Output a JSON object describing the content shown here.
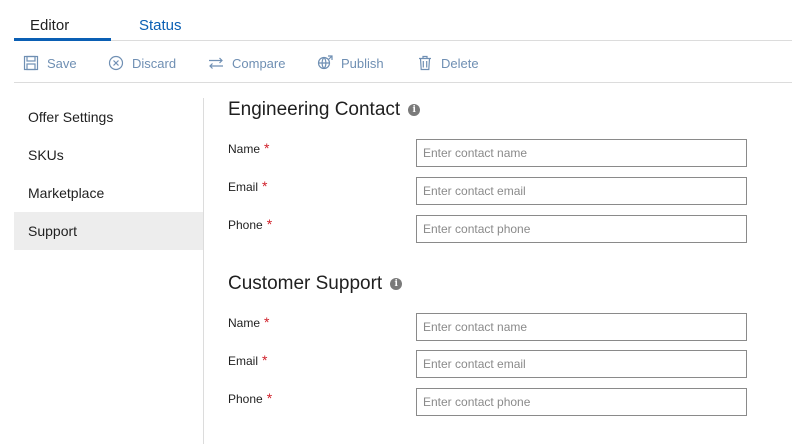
{
  "tabs": [
    {
      "label": "Editor"
    },
    {
      "label": "Status"
    }
  ],
  "toolbar": {
    "save": "Save",
    "discard": "Discard",
    "compare": "Compare",
    "publish": "Publish",
    "delete": "Delete"
  },
  "sidebar": {
    "items": [
      {
        "label": "Offer Settings"
      },
      {
        "label": "SKUs"
      },
      {
        "label": "Marketplace"
      },
      {
        "label": "Support"
      }
    ]
  },
  "engineering": {
    "title": "Engineering Contact",
    "name_label": "Name",
    "name_placeholder": "Enter contact name",
    "email_label": "Email",
    "email_placeholder": "Enter contact email",
    "phone_label": "Phone",
    "phone_placeholder": "Enter contact phone"
  },
  "customer": {
    "title": "Customer Support",
    "name_label": "Name",
    "name_placeholder": "Enter contact name",
    "email_label": "Email",
    "email_placeholder": "Enter contact email",
    "phone_label": "Phone",
    "phone_placeholder": "Enter contact phone"
  },
  "required_mark": "*",
  "info_glyph": "i",
  "colors": {
    "accent": "#0a5fb4",
    "toolbar_text": "#6f8fb3",
    "required": "#d0202a"
  }
}
